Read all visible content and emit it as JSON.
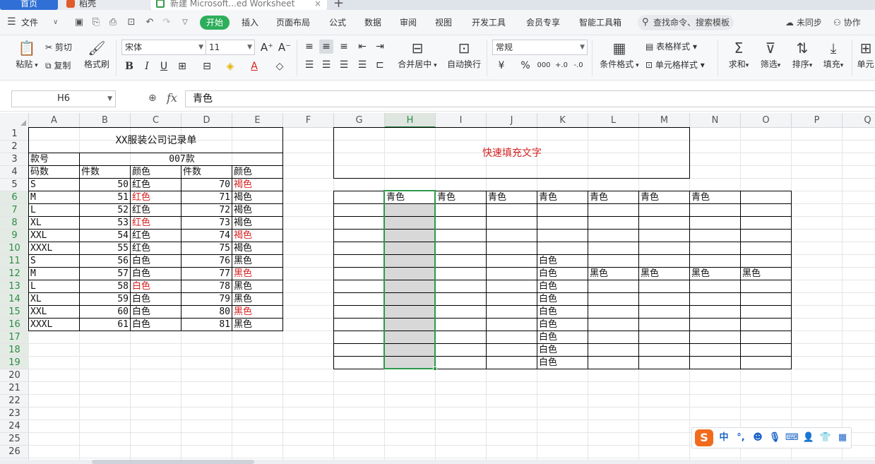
{
  "tabs": {
    "home": "首页",
    "doc": "稻壳",
    "sheet": "新建 Microsoft...ed Worksheet",
    "add": "+"
  },
  "menu": {
    "file": "文件",
    "items": [
      "开始",
      "插入",
      "页面布局",
      "公式",
      "数据",
      "审阅",
      "视图",
      "开发工具",
      "会员专享",
      "智能工具箱"
    ],
    "search_placeholder": "查找命令、搜索模板",
    "sync": "未同步",
    "collab": "协作"
  },
  "ribbon": {
    "paste": "粘贴",
    "cut": "剪切",
    "copy": "复制",
    "format_painter": "格式刷",
    "font_name": "宋体",
    "font_size": "11",
    "merge_center": "合并居中",
    "wrap_text": "自动换行",
    "number_format": "常规",
    "currency": "¥",
    "percent": "%",
    "thousands": "000",
    "inc_decimal": "+.0",
    "dec_decimal": "-.0",
    "conditional_format": "条件格式",
    "table_style": "表格样式",
    "cell_style": "单元格样式",
    "sum": "求和",
    "filter": "筛选",
    "sort": "排序",
    "fill": "填充",
    "cell": "单元"
  },
  "formula_bar": {
    "name_box": "H6",
    "fx": "fx",
    "value": "青色"
  },
  "sheet": {
    "columns": [
      "A",
      "B",
      "C",
      "D",
      "E",
      "F",
      "G",
      "H",
      "I",
      "J",
      "K",
      "L",
      "M",
      "N",
      "O",
      "P",
      "Q"
    ],
    "selected_column": "H",
    "rows": [
      "1",
      "2",
      "3",
      "4",
      "5",
      "6",
      "7",
      "8",
      "9",
      "10",
      "11",
      "12",
      "13",
      "14",
      "15",
      "16",
      "17",
      "18",
      "19",
      "20",
      "21",
      "22",
      "23",
      "24",
      "25",
      "26"
    ],
    "left_table": {
      "title": "XX服装公司记录单",
      "style_label": "款号",
      "style_value": "007款",
      "headers": [
        "码数",
        "件数",
        "颜色",
        "件数",
        "颜色"
      ],
      "rows": [
        [
          "S",
          "50",
          "红色",
          "70",
          "褐色"
        ],
        [
          "M",
          "51",
          "红色",
          "71",
          "褐色"
        ],
        [
          "L",
          "52",
          "红色",
          "72",
          "褐色"
        ],
        [
          "XL",
          "53",
          "红色",
          "73",
          "褐色"
        ],
        [
          "XXL",
          "54",
          "红色",
          "74",
          "褐色"
        ],
        [
          "XXXL",
          "55",
          "红色",
          "75",
          "褐色"
        ],
        [
          "S",
          "56",
          "白色",
          "76",
          "黑色"
        ],
        [
          "M",
          "57",
          "白色",
          "77",
          "黑色"
        ],
        [
          "L",
          "58",
          "白色",
          "78",
          "黑色"
        ],
        [
          "XL",
          "59",
          "白色",
          "79",
          "黑色"
        ],
        [
          "XXL",
          "60",
          "白色",
          "80",
          "黑色"
        ],
        [
          "XXXL",
          "61",
          "白色",
          "81",
          "黑色"
        ]
      ],
      "red_cells": [
        [
          1,
          2
        ],
        [
          3,
          2
        ],
        [
          8,
          2
        ],
        [
          0,
          4
        ],
        [
          4,
          4
        ],
        [
          7,
          4
        ],
        [
          10,
          4
        ]
      ]
    },
    "right_table": {
      "title": "快速填充文字",
      "row6": [
        "青色",
        "青色",
        "青色",
        "青色",
        "青色",
        "青色",
        "青色"
      ],
      "col_k": [
        "白色",
        "白色",
        "白色",
        "白色",
        "白色",
        "白色",
        "白色",
        "白色",
        "白色"
      ],
      "row12": [
        "黑色",
        "黑色",
        "黑色",
        "黑色"
      ]
    }
  },
  "ime": {
    "logo": "S",
    "mode": "中",
    "punct": "°,"
  },
  "colors": {
    "accent_green": "#2dae5a",
    "selection_border": "#2e9a4b",
    "red_text": "#d62020",
    "home_tab": "#2f6fd6"
  }
}
